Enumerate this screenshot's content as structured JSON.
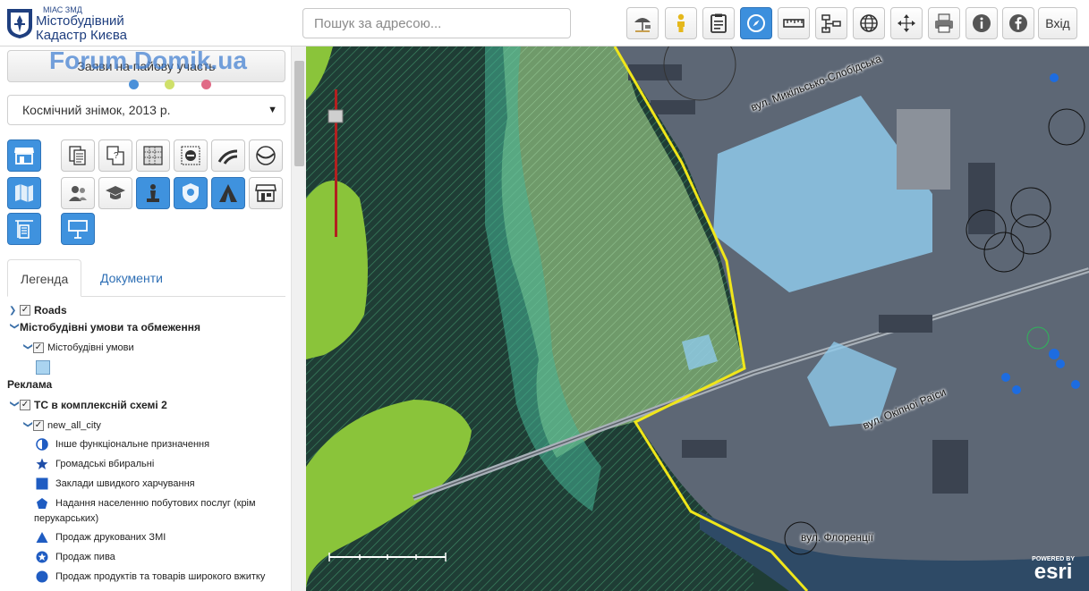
{
  "logo": {
    "subtitle": "МІАС ЗМД",
    "line1": "Містобудівний",
    "line2": "Кадастр Києва"
  },
  "search": {
    "placeholder": "Пошук за адресою..."
  },
  "toolbar": {
    "login_label": "Вхід",
    "buttons": [
      {
        "icon": "beach-umbrella-icon"
      },
      {
        "icon": "person-icon"
      },
      {
        "icon": "clipboard-icon"
      },
      {
        "icon": "compass-icon",
        "active": true
      },
      {
        "icon": "ruler-icon"
      },
      {
        "icon": "hierarchy-icon"
      },
      {
        "icon": "globe-icon"
      },
      {
        "icon": "move-icon"
      },
      {
        "icon": "printer-icon"
      },
      {
        "icon": "info-icon"
      },
      {
        "icon": "facebook-icon"
      }
    ]
  },
  "sidebar": {
    "apply_button": "Заяви на пайову участь",
    "watermark": "Forum.Domik.ua",
    "dots": [
      "#4a90d9",
      "#cfe06a",
      "#e06a86"
    ],
    "basemap": "Космічний знімок, 2013 р.",
    "tabs": {
      "legend": "Легенда",
      "documents": "Документи"
    }
  },
  "legend": {
    "roads": "Roads",
    "urban_conditions": "Містобудівні умови та обмеження",
    "urban_sub": "Містобудівні умови",
    "advertising": "Реклама",
    "ts_scheme": "ТС в комплексній схемі 2",
    "new_all_city": "new_all_city",
    "items": [
      {
        "icon": "half-circle-icon",
        "label": "Інше функціональне призначення"
      },
      {
        "icon": "star-icon",
        "label": "Громадські вбиральні"
      },
      {
        "icon": "square-icon",
        "label": "Заклади швидкого харчування"
      },
      {
        "icon": "pentagon-icon",
        "label": "Надання населенню побутових послуг (крім"
      },
      {
        "icon": "",
        "label": "перукарських)"
      },
      {
        "icon": "triangle-icon",
        "label": "Продаж друкованих ЗМІ"
      },
      {
        "icon": "star-circle-icon",
        "label": "Продаж пива"
      },
      {
        "icon": "circle-icon",
        "label": "Продаж продуктів та товарів широкого вжитку"
      }
    ]
  },
  "map": {
    "streets": {
      "s1": "вул. Микільсько-Слобідська",
      "s2": "вул. Окіпної Раїси",
      "s3": "вул. Флоренції"
    },
    "esri_powered": "POWERED BY",
    "esri": "esri"
  }
}
